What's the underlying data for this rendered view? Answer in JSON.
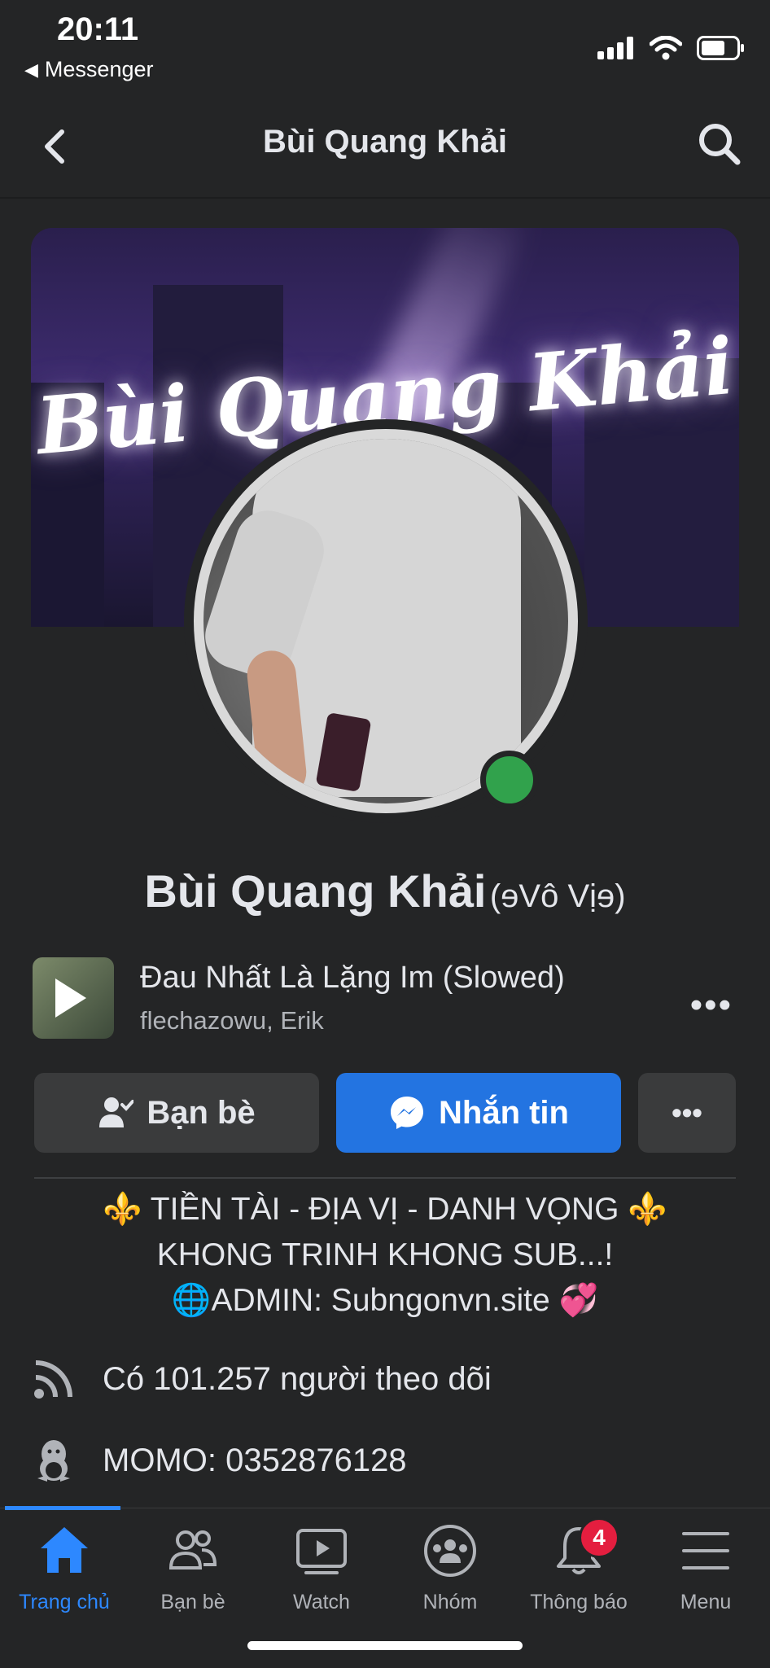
{
  "status_bar": {
    "time": "20:11",
    "back_app": "Messenger"
  },
  "header": {
    "title": "Bùi Quang Khải"
  },
  "cover": {
    "title_text": "Bùi Quang Khải"
  },
  "profile": {
    "name": "Bùi Quang Khải",
    "alternate_name": "(ɘVô Vịɘ)",
    "online": true
  },
  "music": {
    "title": "Đau Nhất Là Lặng Im (Slowed)",
    "artist": "flechazowu, Erik"
  },
  "actions": {
    "friends_label": "Bạn bè",
    "message_label": "Nhắn tin",
    "more_label": "•••"
  },
  "bio": {
    "line1": "TIỀN TÀI - ĐỊA VỊ - DANH VỌNG",
    "line2": "KHONG TRINH KHONG SUB...!",
    "line3": "ADMIN: Subngonvn.site",
    "fleur": "⚜️",
    "globe": "🌐",
    "hearts": "💞"
  },
  "info": {
    "followers": "Có 101.257 người theo dõi",
    "momo": "MOMO: 0352876128"
  },
  "nav": {
    "items": [
      {
        "label": "Trang chủ",
        "icon": "home-icon",
        "active": true
      },
      {
        "label": "Bạn bè",
        "icon": "friends-icon"
      },
      {
        "label": "Watch",
        "icon": "watch-icon"
      },
      {
        "label": "Nhóm",
        "icon": "groups-icon"
      },
      {
        "label": "Thông báo",
        "icon": "bell-icon",
        "badge": "4"
      },
      {
        "label": "Menu",
        "icon": "menu-icon"
      }
    ]
  },
  "colors": {
    "accent": "#2374e1",
    "online": "#31a24c",
    "badge": "#e41e3f",
    "background": "#242526"
  }
}
